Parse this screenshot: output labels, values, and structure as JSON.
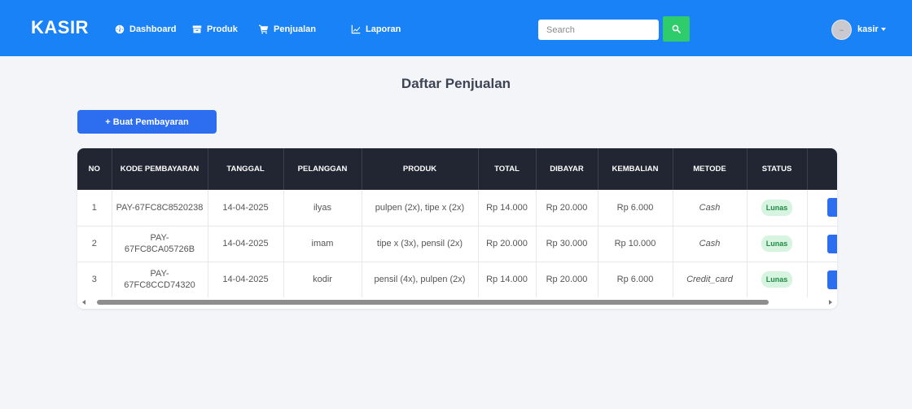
{
  "navbar": {
    "brand": "KASIR",
    "items": [
      {
        "label": "Dashboard",
        "icon": "tachometer-icon"
      },
      {
        "label": "Produk",
        "icon": "box-icon"
      },
      {
        "label": "Penjualan",
        "icon": "cart-icon"
      },
      {
        "label": "Laporan",
        "icon": "chart-line-icon"
      }
    ],
    "search_placeholder": "Search",
    "user": "kasir",
    "colors": {
      "bar": "#1a82f7",
      "search_button": "#2ecc6a"
    }
  },
  "page": {
    "title": "Daftar Penjualan",
    "add_button": "+ Buat Pembayaran"
  },
  "table": {
    "columns": [
      "NO",
      "KODE PEMBAYARAN",
      "TANGGAL",
      "PELANGGAN",
      "PRODUK",
      "TOTAL",
      "DIBAYAR",
      "KEMBALIAN",
      "METODE",
      "STATUS",
      ""
    ],
    "rows": [
      {
        "no": "1",
        "kode": "PAY-67FC8C8520238",
        "tanggal": "14-04-2025",
        "pelanggan": "ilyas",
        "produk": "pulpen (2x), tipe x (2x)",
        "total": "Rp 14.000",
        "dibayar": "Rp 20.000",
        "kembalian": "Rp 6.000",
        "metode": "Cash",
        "status": "Lunas"
      },
      {
        "no": "2",
        "kode": "PAY-67FC8CA05726B",
        "tanggal": "14-04-2025",
        "pelanggan": "imam",
        "produk": "tipe x (3x), pensil (2x)",
        "total": "Rp 20.000",
        "dibayar": "Rp 30.000",
        "kembalian": "Rp 10.000",
        "metode": "Cash",
        "status": "Lunas"
      },
      {
        "no": "3",
        "kode": "PAY-67FC8CCD74320",
        "tanggal": "14-04-2025",
        "pelanggan": "kodir",
        "produk": "pensil (4x), pulpen (2x)",
        "total": "Rp 14.000",
        "dibayar": "Rp 20.000",
        "kembalian": "Rp 6.000",
        "metode": "Credit_card",
        "status": "Lunas"
      }
    ],
    "colors": {
      "header": "#212632",
      "badge_bg": "#d6f4df",
      "badge_text": "#1f8a44",
      "action": "#2d6ef0"
    }
  }
}
